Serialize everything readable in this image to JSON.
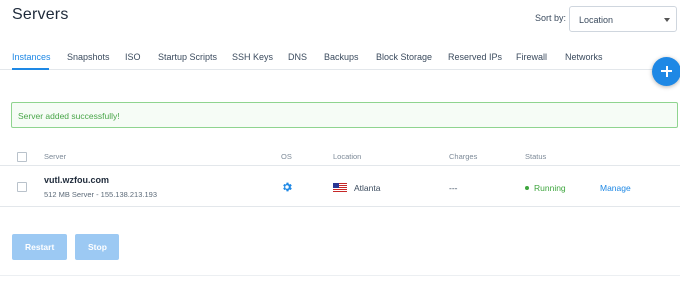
{
  "header": {
    "title": "Servers"
  },
  "sort": {
    "label": "Sort by:",
    "selected": "Location"
  },
  "tabs": [
    {
      "label": "Instances",
      "active": true
    },
    {
      "label": "Snapshots"
    },
    {
      "label": "ISO"
    },
    {
      "label": "Startup Scripts"
    },
    {
      "label": "SSH Keys"
    },
    {
      "label": "DNS"
    },
    {
      "label": "Backups"
    },
    {
      "label": "Block Storage"
    },
    {
      "label": "Reserved IPs"
    },
    {
      "label": "Firewall"
    },
    {
      "label": "Networks"
    }
  ],
  "alert": {
    "message": "Server added successfully!"
  },
  "table": {
    "columns": [
      "Server",
      "OS",
      "Location",
      "Charges",
      "Status"
    ],
    "rows": [
      {
        "name": "vutl.wzfou.com",
        "meta": "512 MB Server - 155.138.213.193",
        "os_icon": "gear-icon",
        "location_flag": "us-flag-icon",
        "location": "Atlanta",
        "charges": "---",
        "status": "Running",
        "action": "Manage"
      }
    ]
  },
  "actions": {
    "restart": "Restart",
    "stop": "Stop"
  },
  "colors": {
    "accent": "#1e88e5",
    "success": "#3ea63e",
    "alert_border": "#8fd48f",
    "button_disabled": "#9cc9f3"
  }
}
